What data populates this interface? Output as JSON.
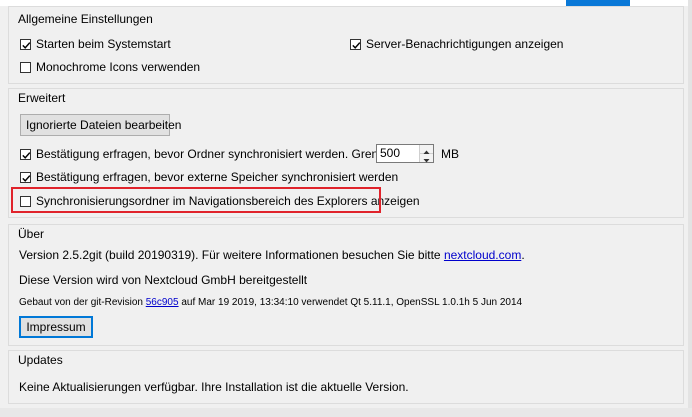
{
  "general": {
    "title": "Allgemeine Einstellungen",
    "start_on_boot": {
      "label": "Starten beim Systemstart",
      "checked": true
    },
    "server_notifications": {
      "label": "Server-Benachrichtigungen anzeigen",
      "checked": true
    },
    "monochrome_icons": {
      "label": "Monochrome Icons verwenden",
      "checked": false
    }
  },
  "advanced": {
    "title": "Erweitert",
    "ignored_files_button": "Ignorierte Dateien bearbeiten",
    "confirm_folder_sync": {
      "label": "Bestätigung erfragen, bevor Ordner synchronisiert werden. Grenze:",
      "checked": true
    },
    "limit_value": "500",
    "limit_unit": "MB",
    "confirm_external": {
      "label": "Bestätigung erfragen, bevor externe Speicher synchronisiert werden",
      "checked": true
    },
    "explorer_nav": {
      "label": "Synchronisierungsordner im Navigationsbereich des Explorers anzeigen",
      "checked": false
    }
  },
  "about": {
    "title": "Über",
    "version_prefix": "Version 2.5.2git (build 20190319). Für weitere Informationen besuchen Sie bitte ",
    "website_link": "nextcloud.com",
    "version_suffix": ".",
    "provided_by": "Diese Version wird von Nextcloud GmbH bereitgestellt",
    "build_prefix": "Gebaut von der git-Revision ",
    "revision_link": "56c905",
    "build_suffix": " auf Mar 19 2019, 13:34:10 verwendet Qt 5.11.1, OpenSSL 1.0.1h 5 Jun 2014",
    "imprint_button": "Impressum"
  },
  "updates": {
    "title": "Updates",
    "status": "Keine Aktualisierungen verfügbar. Ihre Installation ist die aktuelle Version."
  },
  "colors": {
    "highlight_border": "#e0232b",
    "link": "#0000cc",
    "focus_border": "#0078d7"
  }
}
